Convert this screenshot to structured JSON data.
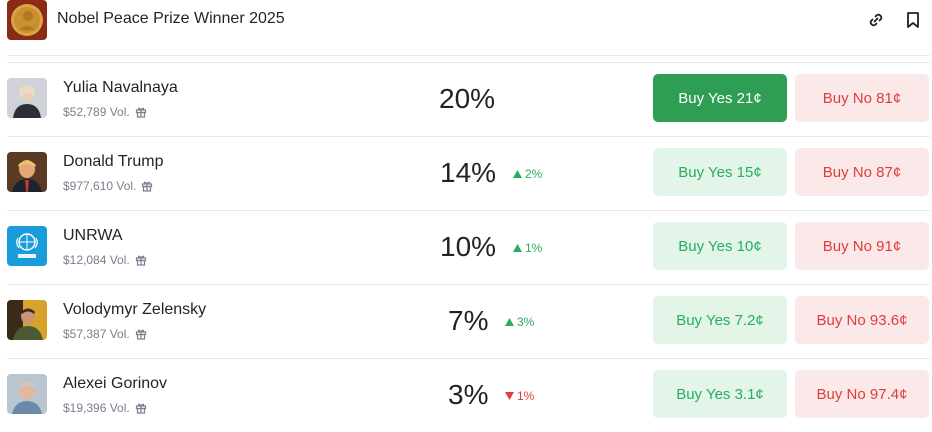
{
  "header": {
    "title": "Nobel Peace Prize Winner 2025",
    "logo_icon": "nobel-medal-icon",
    "link_icon": "link-icon",
    "bookmark_icon": "bookmark-icon"
  },
  "colors": {
    "yes_green": "#27ae60",
    "yes_active_bg": "#2f9e55",
    "yes_bg": "#e3f5e9",
    "no_red": "#e23b3b",
    "no_bg": "#fbe8e8"
  },
  "rows": [
    {
      "name": "Yulia Navalnaya",
      "volume": "$52,789 Vol.",
      "percent": "20%",
      "change": "",
      "direction": "",
      "yes_label": "Buy Yes 21¢",
      "no_label": "Buy No 81¢",
      "yes_active": true
    },
    {
      "name": "Donald Trump",
      "volume": "$977,610 Vol.",
      "percent": "14%",
      "change": "2%",
      "direction": "up",
      "yes_label": "Buy Yes 15¢",
      "no_label": "Buy No 87¢",
      "yes_active": false
    },
    {
      "name": "UNRWA",
      "volume": "$12,084 Vol.",
      "percent": "10%",
      "change": "1%",
      "direction": "up",
      "yes_label": "Buy Yes 10¢",
      "no_label": "Buy No 91¢",
      "yes_active": false
    },
    {
      "name": "Volodymyr Zelensky",
      "volume": "$57,387 Vol.",
      "percent": "7%",
      "change": "3%",
      "direction": "up",
      "yes_label": "Buy Yes 7.2¢",
      "no_label": "Buy No 93.6¢",
      "yes_active": false
    },
    {
      "name": "Alexei Gorinov",
      "volume": "$19,396 Vol.",
      "percent": "3%",
      "change": "1%",
      "direction": "down",
      "yes_label": "Buy Yes 3.1¢",
      "no_label": "Buy No 97.4¢",
      "yes_active": false
    }
  ]
}
